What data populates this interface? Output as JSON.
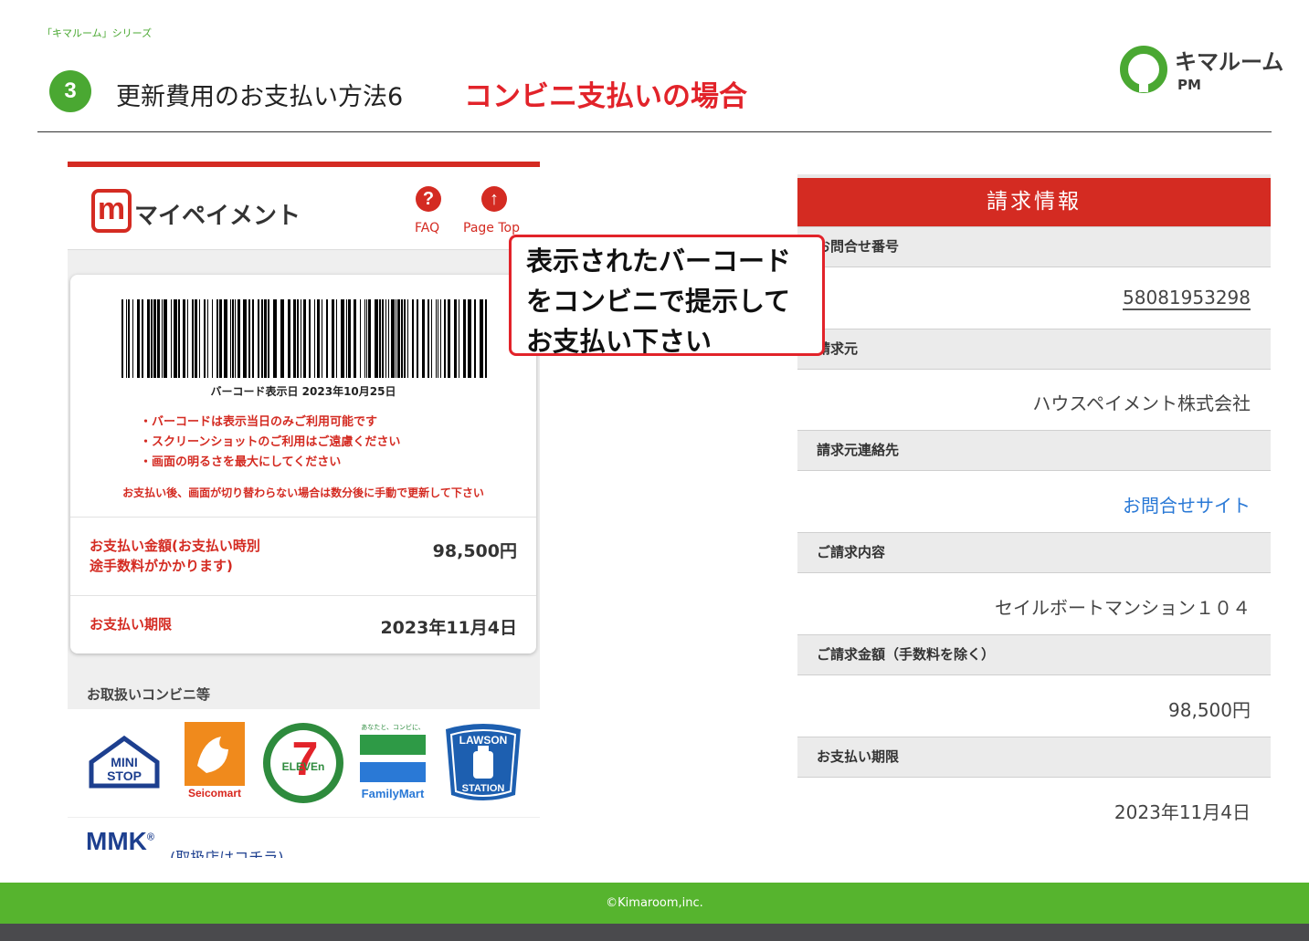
{
  "page": {
    "series": "「キマルーム」シリーズ",
    "step_number": "3",
    "title": "更新費用のお支払い方法6",
    "subtitle": "コンビニ支払いの場合",
    "logo_name": "キマルーム",
    "logo_pm": "PM",
    "footer": "©Kimaroom,inc.",
    "colors": {
      "brand_green": "#4aa832",
      "accent_red": "#e2232a",
      "payment_red": "#d42b22",
      "link_blue": "#2a79d6"
    }
  },
  "phone": {
    "logo_mark": "m",
    "app_name": "マイペイメント",
    "faq_icon": "question-circle-icon",
    "faq_label": "FAQ",
    "pagetop_icon": "arrow-up-circle-icon",
    "pagetop_label": "Page Top",
    "barcode_date": "バーコード表示日 2023年10月25日",
    "notes": [
      "・バーコードは表示当日のみご利用可能です",
      "・スクリーンショットのご利用はご遠慮ください",
      "・画面の明るさを最大にしてください"
    ],
    "note_after": "お支払い後、画面が切り替わらない場合は数分後に手動で更新して下さい",
    "amount_label_1": "お支払い金額(お支払い時別",
    "amount_label_2": "途手数料がかかります)",
    "amount_value": "98,500円",
    "due_label": "お支払い期限",
    "due_value": "2023年11月4日",
    "stores_title": "お取扱いコンビニ等",
    "stores": {
      "ministop_1": "MINI",
      "ministop_2": "STOP",
      "seicomart": "Seicomart",
      "seven_num": "7",
      "seven_text": "ELEVEn",
      "familymart_tag": "あなたと、コンビに、",
      "familymart": "FamilyMart",
      "lawson_top": "LAWSON",
      "lawson_bottom": "STATION"
    },
    "mmk": "MMK",
    "mmk_reg": "®",
    "mmk_link": "(取扱店はコチラ)"
  },
  "callout": {
    "lines": [
      "表示されたバーコード",
      "をコンビニで提示して",
      "お支払い下さい"
    ]
  },
  "billing": {
    "header": "請求情報",
    "rows": [
      {
        "label": "お問合せ番号",
        "value": "58081953298"
      },
      {
        "label": "請求元",
        "value": "ハウスペイメント株式会社"
      },
      {
        "label": "請求元連絡先",
        "value": "お問合せサイト"
      },
      {
        "label": "ご請求内容",
        "value": "セイルボートマンション１０４"
      },
      {
        "label": "ご請求金額（手数料を除く）",
        "value": "98,500円"
      },
      {
        "label": "お支払い期限",
        "value": "2023年11月4日"
      }
    ]
  }
}
